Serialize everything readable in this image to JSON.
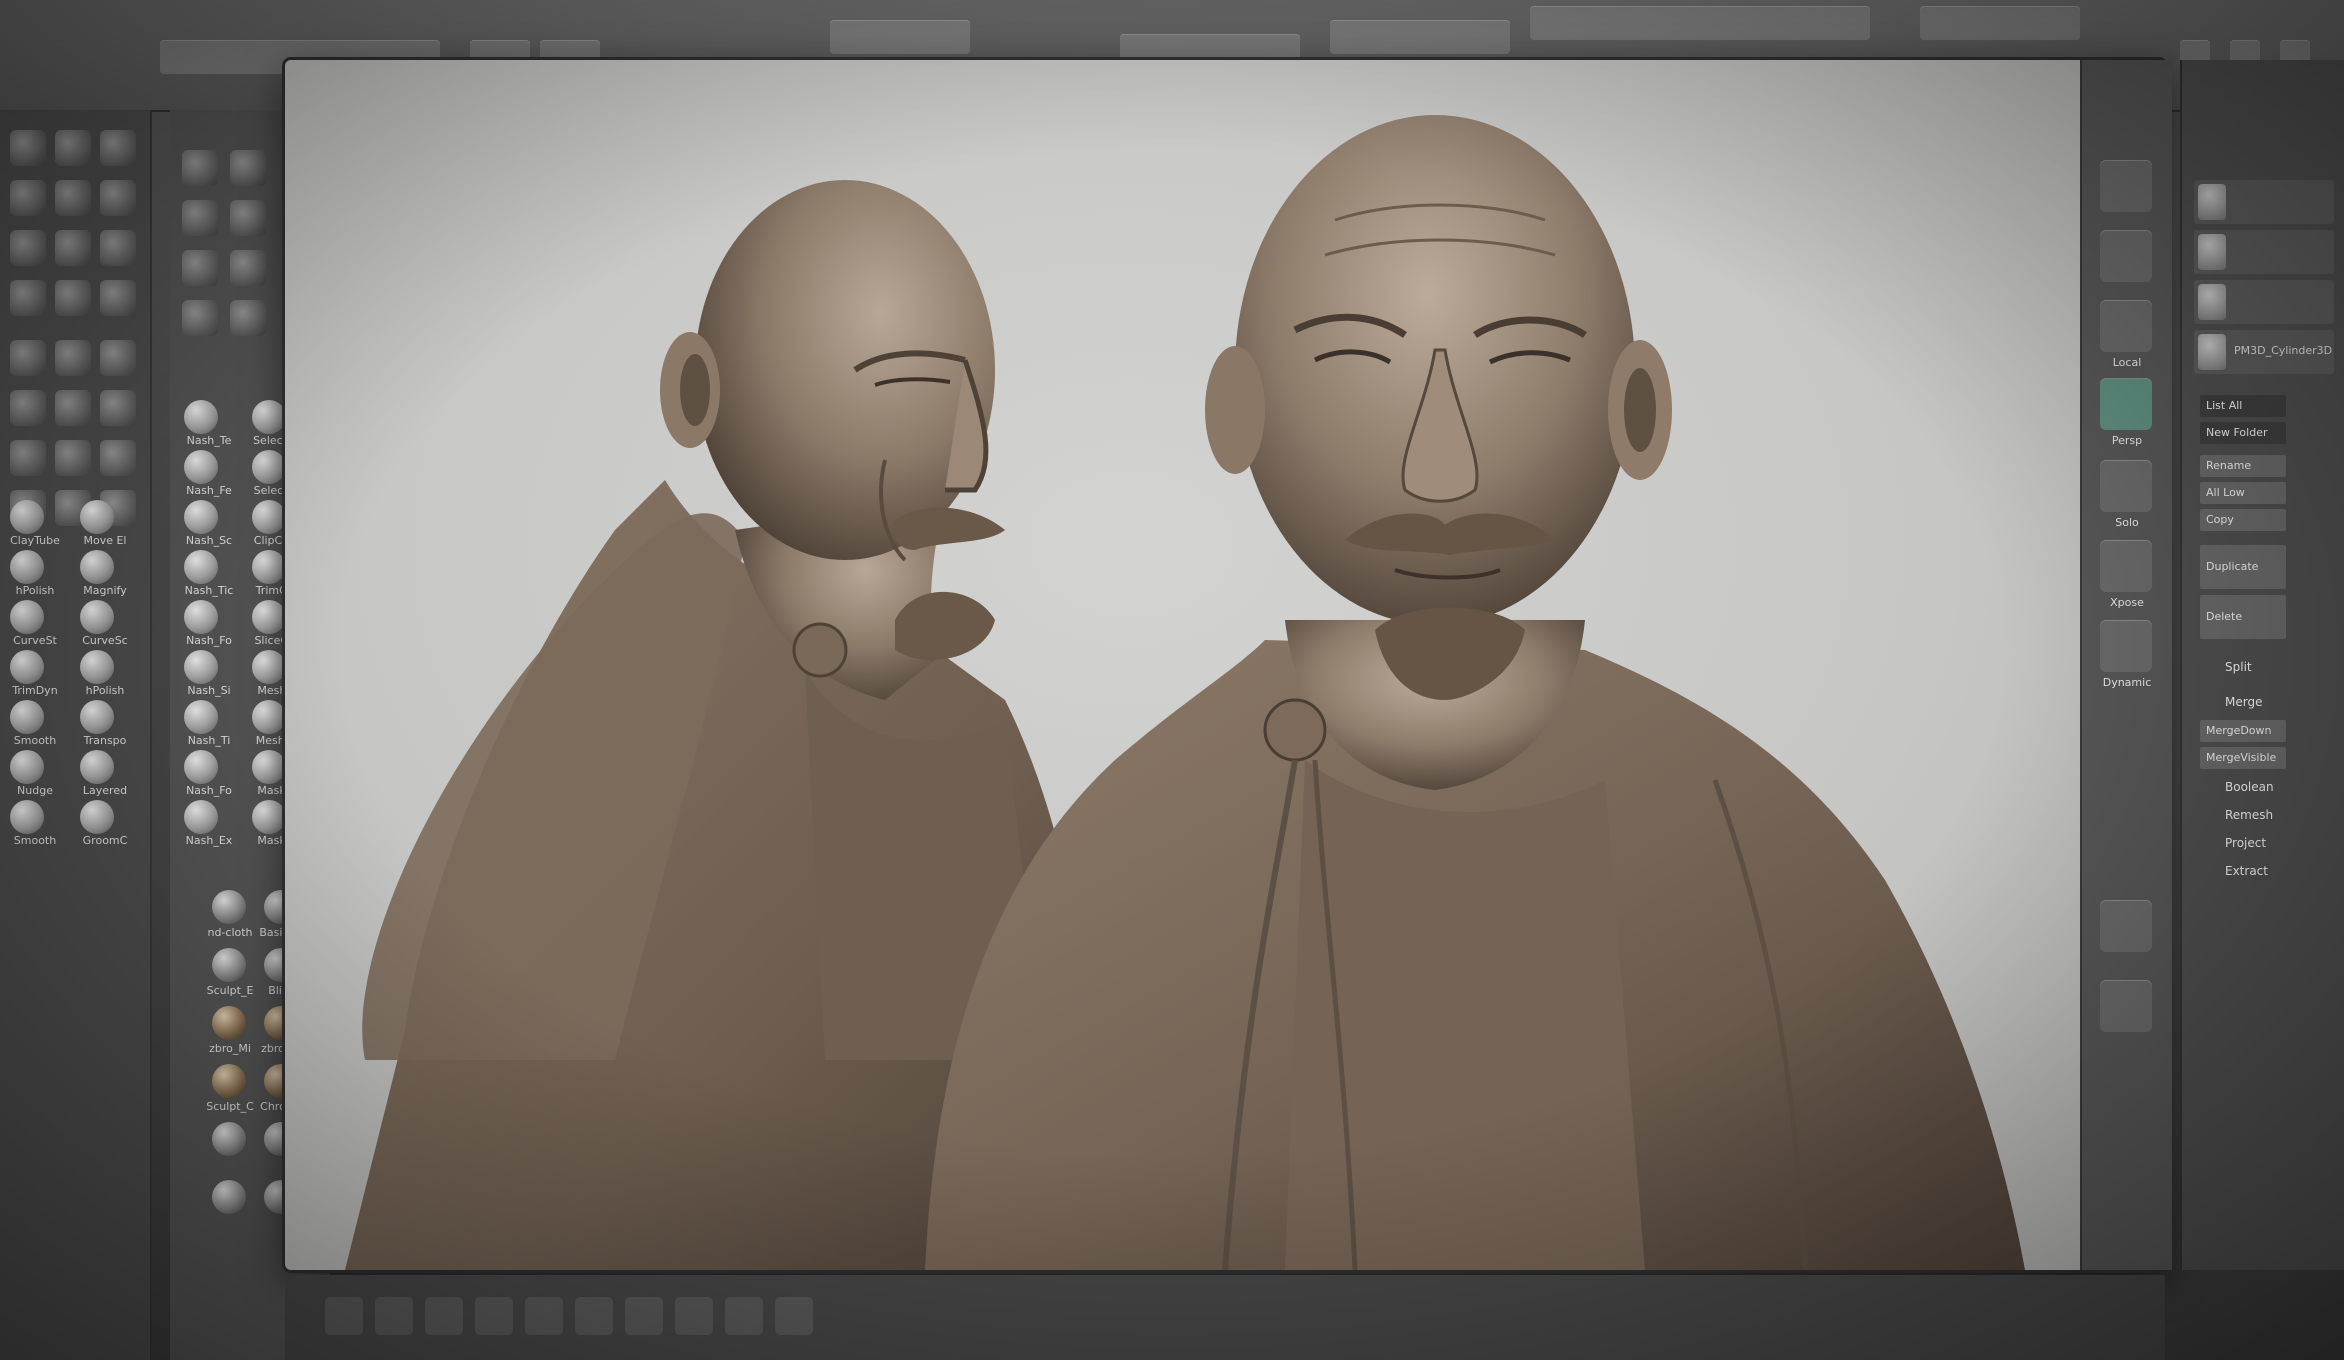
{
  "app": {
    "name": ""
  },
  "brush_shelf": {
    "items": [
      {
        "label": "Nash_Te",
        "icon": "brush-sphere-icon"
      },
      {
        "label": "SelectRe",
        "icon": "select-rect-icon"
      },
      {
        "label": "Nash_Fe",
        "icon": "brush-sphere-icon"
      },
      {
        "label": "SelectLa",
        "icon": "select-lasso-icon"
      },
      {
        "label": "Nash_Sc",
        "icon": "brush-sphere-icon"
      },
      {
        "label": "ClipCurv",
        "icon": "clip-curve-icon"
      },
      {
        "label": "Nash_Tic",
        "icon": "brush-sphere-icon"
      },
      {
        "label": "TrimCur",
        "icon": "trim-curve-icon"
      },
      {
        "label": "Nash_Fo",
        "icon": "brush-sphere-icon"
      },
      {
        "label": "SliceCur",
        "icon": "slice-curve-icon"
      },
      {
        "label": "Nash_Si",
        "icon": "brush-sphere-icon"
      },
      {
        "label": "MeshIn",
        "icon": "mesh-insert-icon"
      },
      {
        "label": "Nash_Ti",
        "icon": "brush-sphere-icon"
      },
      {
        "label": "MeshEx",
        "icon": "mesh-extract-icon"
      },
      {
        "label": "Nash_Fo",
        "icon": "brush-sphere-icon"
      },
      {
        "label": "Masker",
        "icon": "mask-icon"
      },
      {
        "label": "Nash_Ex",
        "icon": "brush-sphere-icon"
      },
      {
        "label": "Masker",
        "icon": "mask-icon"
      }
    ],
    "left_column": [
      {
        "label": "ClayTube"
      },
      {
        "label": "Move El"
      },
      {
        "label": "hPolish"
      },
      {
        "label": "Magnify"
      },
      {
        "label": "CurveSt"
      },
      {
        "label": "CurveSc"
      },
      {
        "label": "TrimDyn"
      },
      {
        "label": "hPolish"
      },
      {
        "label": "Smooth"
      },
      {
        "label": "Transpo"
      },
      {
        "label": "Nudge"
      },
      {
        "label": "Layered"
      },
      {
        "label": "Smooth"
      },
      {
        "label": "GroomC"
      }
    ]
  },
  "material_shelf": {
    "items": [
      {
        "label": "nd-cloth",
        "kind": "gray"
      },
      {
        "label": "BasicMa",
        "kind": "gray"
      },
      {
        "label": "Sculpt_E",
        "kind": "gray"
      },
      {
        "label": "Blinn",
        "kind": "gray"
      },
      {
        "label": "zbro_Mi",
        "kind": "bronze"
      },
      {
        "label": "zbro_Mi",
        "kind": "bronze"
      },
      {
        "label": "Sculpt_C",
        "kind": "bronze"
      },
      {
        "label": "Chro_Mi",
        "kind": "bronze"
      }
    ]
  },
  "right_shelf": {
    "buttons": [
      {
        "label": "",
        "icon": "rotate-icon"
      },
      {
        "label": "",
        "icon": "frame-icon"
      },
      {
        "label": "Local",
        "icon": "local-icon"
      },
      {
        "label": "Persp",
        "icon": "persp-icon",
        "active": true
      },
      {
        "label": "Solo",
        "icon": "solo-icon"
      },
      {
        "label": "Xpose",
        "icon": "xpose-icon"
      },
      {
        "label": "Dynamic",
        "icon": "dynamic-icon"
      }
    ]
  },
  "tool_panel": {
    "subtools": [
      {
        "name": "",
        "icon": "subtool-thumb-icon"
      },
      {
        "name": "",
        "icon": "subtool-thumb-icon"
      },
      {
        "name": "",
        "icon": "subtool-thumb-icon"
      },
      {
        "name": "PM3D_Cylinder3D",
        "icon": "subtool-thumb-icon"
      }
    ],
    "buttons": [
      {
        "label": "List All"
      },
      {
        "label": "New Folder"
      },
      {
        "label": "Rename"
      },
      {
        "label": "All Low"
      },
      {
        "label": "Copy"
      },
      {
        "label": "Duplicate"
      },
      {
        "label": "Delete"
      }
    ],
    "split_label": "Split",
    "merge_label": "Merge",
    "merge_buttons": [
      {
        "label": "MergeDown"
      },
      {
        "label": "MergeVisible"
      }
    ],
    "extra_buttons": [
      {
        "label": "Boolean"
      },
      {
        "label": "Remesh"
      },
      {
        "label": "Project"
      },
      {
        "label": "Extract"
      }
    ]
  },
  "colors": {
    "canvas": "#c9c9c7",
    "clay": "#8a7766",
    "clay_highlight": "#b5a392",
    "clay_shadow": "#4f4237",
    "ui_dark": "#4d4d4d"
  }
}
